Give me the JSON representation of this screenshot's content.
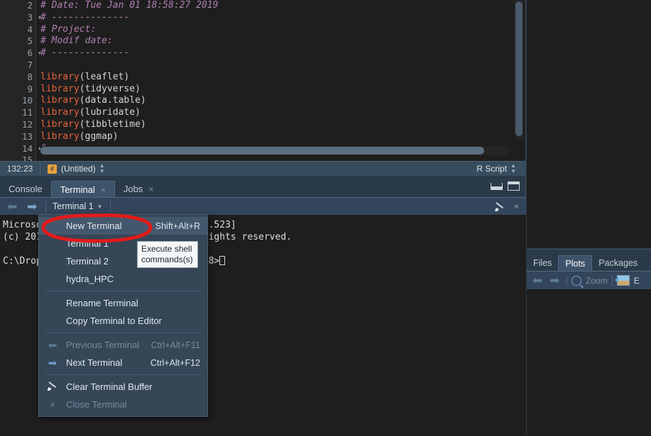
{
  "editor": {
    "lines": [
      {
        "num": "2",
        "fold": false,
        "segments": [
          {
            "cls": "cm",
            "text": "# Date: Tue Jan 01 18:58:27 2019"
          }
        ]
      },
      {
        "num": "3",
        "fold": true,
        "segments": [
          {
            "cls": "cm",
            "text": "# --------------"
          }
        ]
      },
      {
        "num": "4",
        "fold": false,
        "segments": [
          {
            "cls": "cm",
            "text": "# Project:"
          }
        ]
      },
      {
        "num": "5",
        "fold": false,
        "segments": [
          {
            "cls": "cm",
            "text": "# Modif date:"
          }
        ]
      },
      {
        "num": "6",
        "fold": true,
        "segments": [
          {
            "cls": "cm",
            "text": "# --------------"
          }
        ]
      },
      {
        "num": "7",
        "fold": false,
        "segments": [
          {
            "cls": "pl",
            "text": ""
          }
        ]
      },
      {
        "num": "8",
        "fold": false,
        "segments": [
          {
            "cls": "fn",
            "text": "library"
          },
          {
            "cls": "pl",
            "text": "(leaflet)"
          }
        ]
      },
      {
        "num": "9",
        "fold": false,
        "segments": [
          {
            "cls": "fn",
            "text": "library"
          },
          {
            "cls": "pl",
            "text": "(tidyverse)"
          }
        ]
      },
      {
        "num": "10",
        "fold": false,
        "segments": [
          {
            "cls": "fn",
            "text": "library"
          },
          {
            "cls": "pl",
            "text": "(data.table)"
          }
        ]
      },
      {
        "num": "11",
        "fold": false,
        "segments": [
          {
            "cls": "fn",
            "text": "library"
          },
          {
            "cls": "pl",
            "text": "(lubridate)"
          }
        ]
      },
      {
        "num": "12",
        "fold": false,
        "segments": [
          {
            "cls": "fn",
            "text": "library"
          },
          {
            "cls": "pl",
            "text": "(tibbletime)"
          }
        ]
      },
      {
        "num": "13",
        "fold": false,
        "segments": [
          {
            "cls": "fn",
            "text": "library"
          },
          {
            "cls": "pl",
            "text": "(ggmap)"
          }
        ]
      },
      {
        "num": "14",
        "fold": true,
        "segments": [
          {
            "cls": "cm",
            "text": "# ----------------------------------------------------------------------"
          }
        ]
      },
      {
        "num": "15",
        "fold": false,
        "segments": [
          {
            "cls": "pl",
            "text": ""
          }
        ]
      }
    ],
    "status": {
      "cursor_position": "132:23",
      "file_badge": "#",
      "file_name": "(Untitled)",
      "doc_type": "R Script"
    }
  },
  "console_panel": {
    "tabs": [
      {
        "label": "Console",
        "active": false,
        "closable": false
      },
      {
        "label": "Terminal",
        "active": true,
        "closable": true
      },
      {
        "label": "Jobs",
        "active": false,
        "closable": true
      }
    ],
    "close_glyph": "×",
    "window_controls": {
      "minimize": "minimize-icon",
      "maximize": "maximize-icon"
    },
    "toolbar": {
      "back_arrow": "⬅",
      "forward_arrow": "➡",
      "terminal_selector": "Terminal 1",
      "caret": "▼",
      "clear_icon": "broom-icon",
      "close_icon": "×"
    },
    "output_lines": [
      "Microsoft Windows [Version 10.0.17134.523]",
      "(c) 2018 Microsoft Corporation. All rights reserved.",
      "",
      "C:\\Dropbox\\projects\\work\\sl_paper_2018>"
    ]
  },
  "context_menu": {
    "items": [
      {
        "type": "item",
        "icon": "",
        "label": "New Terminal",
        "shortcut": "Shift+Alt+R",
        "highlighted": true,
        "disabled": false
      },
      {
        "type": "item",
        "icon": "",
        "label": "Terminal 1",
        "shortcut": "",
        "highlighted": false,
        "disabled": false
      },
      {
        "type": "item",
        "icon": "",
        "label": "Terminal 2",
        "shortcut": "",
        "highlighted": false,
        "disabled": false
      },
      {
        "type": "item",
        "icon": "",
        "label": "hydra_HPC",
        "shortcut": "",
        "highlighted": false,
        "disabled": false
      },
      {
        "type": "separator"
      },
      {
        "type": "item",
        "icon": "",
        "label": "Rename Terminal",
        "shortcut": "",
        "highlighted": false,
        "disabled": false
      },
      {
        "type": "item",
        "icon": "",
        "label": "Copy Terminal to Editor",
        "shortcut": "",
        "highlighted": false,
        "disabled": false
      },
      {
        "type": "separator"
      },
      {
        "type": "item",
        "icon": "arrow-left-icon",
        "label": "Previous Terminal",
        "shortcut": "Ctrl+Alt+F11",
        "highlighted": false,
        "disabled": true
      },
      {
        "type": "item",
        "icon": "arrow-right-icon",
        "label": "Next Terminal",
        "shortcut": "Ctrl+Alt+F12",
        "highlighted": false,
        "disabled": false
      },
      {
        "type": "separator"
      },
      {
        "type": "item",
        "icon": "broom-icon",
        "label": "Clear Terminal Buffer",
        "shortcut": "",
        "highlighted": false,
        "disabled": false
      },
      {
        "type": "item",
        "icon": "close-x-icon",
        "label": "Close Terminal",
        "shortcut": "",
        "highlighted": false,
        "disabled": true
      }
    ]
  },
  "tooltip": {
    "text": "Execute shell commands(s)"
  },
  "annotation": {
    "shape": "red-ellipse",
    "color": "#e01b1b",
    "target": "New Terminal"
  },
  "right_panel": {
    "tabs": [
      {
        "label": "Files",
        "active": false
      },
      {
        "label": "Plots",
        "active": true
      },
      {
        "label": "Packages",
        "active": false
      }
    ],
    "toolbar": {
      "back_arrow": "⬅",
      "forward_arrow": "➡",
      "zoom_label": "Zoom",
      "export_label": "E"
    }
  },
  "colors": {
    "editor_bg": "#1e1e1e",
    "panel_bg": "#2b3a49",
    "tab_active_bg": "#3d536a",
    "accent_orange": "#e8633a",
    "comment_purple": "#b07fb0",
    "annotation_red": "#e01b1b",
    "badge_orange": "#e8a33d"
  }
}
